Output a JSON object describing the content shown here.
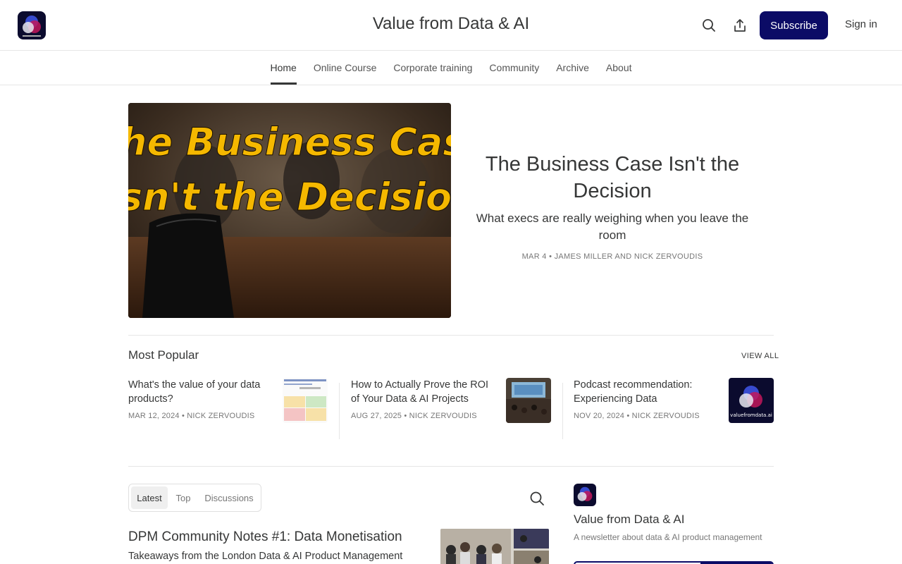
{
  "header": {
    "title": "Value from Data & AI",
    "subscribe_label": "Subscribe",
    "signin_label": "Sign in",
    "accent_color": "#0b0b66"
  },
  "nav": {
    "items": [
      {
        "label": "Home",
        "active": true
      },
      {
        "label": "Online Course"
      },
      {
        "label": "Corporate training"
      },
      {
        "label": "Community"
      },
      {
        "label": "Archive"
      },
      {
        "label": "About"
      }
    ]
  },
  "hero": {
    "image_line1": "he Business Case",
    "image_line2": "sn't the Decision",
    "title": "The Business Case Isn't the Decision",
    "subtitle": "What execs are really weighing when you leave the room",
    "meta": "MAR 4 • JAMES MILLER AND NICK ZERVOUDIS"
  },
  "most_popular": {
    "heading": "Most Popular",
    "view_all": "VIEW ALL",
    "posts": [
      {
        "title": "What's the value of your data products?",
        "meta": "MAR 12, 2024 • NICK ZERVOUDIS"
      },
      {
        "title": "How to Actually Prove the ROI of Your Data & AI Projects",
        "meta": "AUG 27, 2025 • NICK ZERVOUDIS"
      },
      {
        "title": "Podcast recommendation: Experiencing Data",
        "meta": "NOV 20, 2024 • NICK ZERVOUDIS",
        "thumb_text": "valuefromdata.ai"
      }
    ]
  },
  "feed": {
    "tabs": [
      {
        "label": "Latest",
        "active": true
      },
      {
        "label": "Top"
      },
      {
        "label": "Discussions"
      }
    ],
    "latest_post": {
      "title": "DPM Community Notes #1: Data Monetisation",
      "subtitle": "Takeaways from the London Data & AI Product Management"
    }
  },
  "sidebar": {
    "name": "Value from Data & AI",
    "description": "A newsletter about data & AI product management"
  }
}
